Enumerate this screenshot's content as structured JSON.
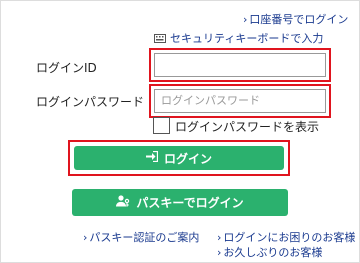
{
  "links": {
    "account_login": "口座番号でログイン",
    "security_keyboard": "セキュリティキーボードで入力",
    "passkey_auth": "パスキー認証のご案内",
    "login_trouble": "ログインにお困りのお客様",
    "long_time": "お久しぶりのお客様"
  },
  "form": {
    "login_id_label": "ログインID",
    "login_id_value": "",
    "password_label": "ログインパスワード",
    "password_placeholder": "ログインパスワード",
    "show_password_label": "ログインパスワードを表示",
    "show_password_checked": false
  },
  "buttons": {
    "login": "ログイン",
    "passkey_login": "パスキーでログイン"
  },
  "colors": {
    "button_green": "#2bb16e",
    "highlight_red": "#e0141e",
    "link_blue": "#1a3a8f"
  }
}
